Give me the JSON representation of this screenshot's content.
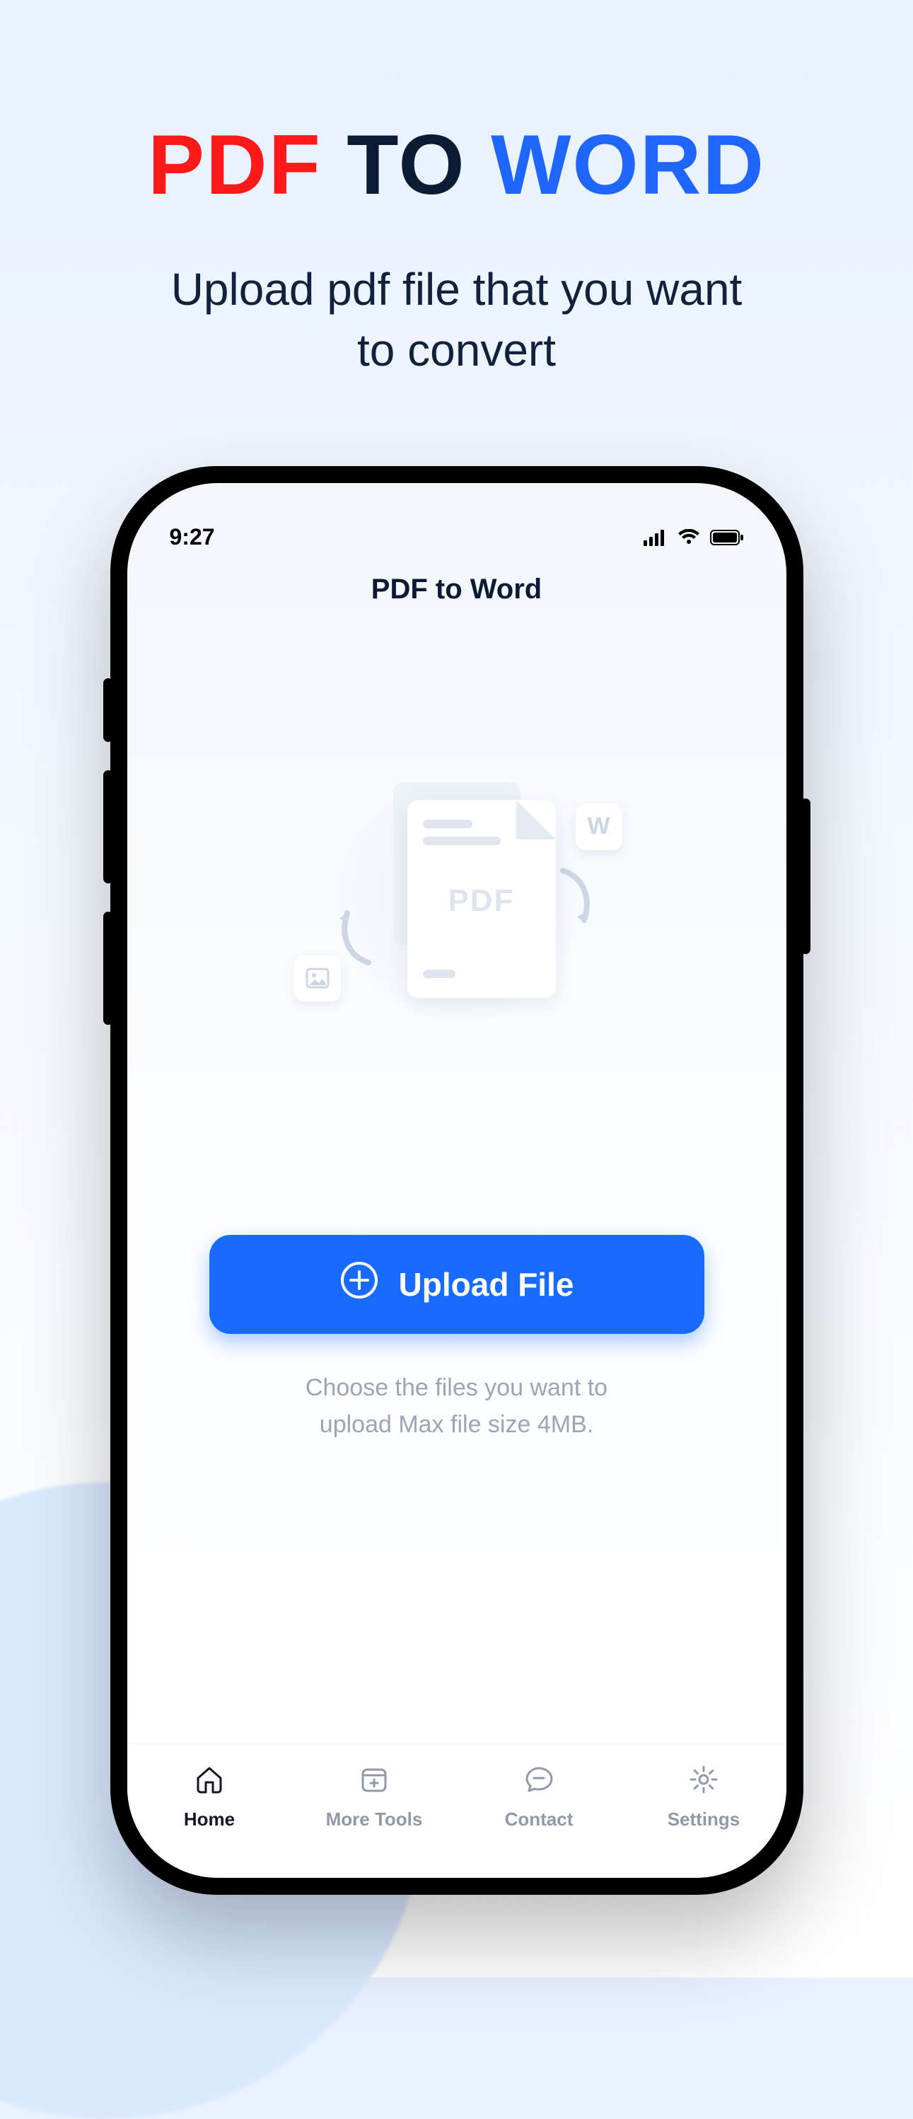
{
  "marketing": {
    "title_pdf": "PDF",
    "title_to": "TO",
    "title_word": "WORD",
    "subtitle_line1": "Upload pdf file that you want",
    "subtitle_line2": "to convert"
  },
  "statusbar": {
    "time": "9:27"
  },
  "app": {
    "header": "PDF to Word",
    "illustration": {
      "pdf_label": "PDF",
      "word_tag": "W"
    },
    "upload_button": "Upload File",
    "hint_line1": "Choose the files you want to",
    "hint_line2": "upload Max file size 4MB."
  },
  "tabs": {
    "home": "Home",
    "more": "More Tools",
    "contact": "Contact",
    "settings": "Settings"
  }
}
